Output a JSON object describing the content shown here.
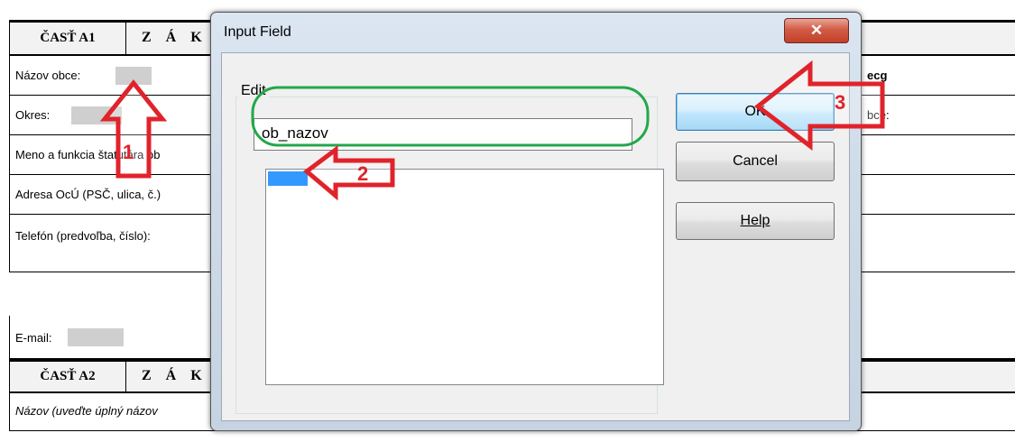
{
  "form": {
    "sectionA1": {
      "part": "ČASŤ A1",
      "heading": "Z Á K"
    },
    "rows": [
      {
        "label": "Názov obce:",
        "right_text": "ecg"
      },
      {
        "label": "Okres:",
        "right_text": "bce:"
      },
      {
        "label": "Meno a funkcia štatutára ob"
      },
      {
        "label": "Adresa OcÚ (PSČ, ulica, č.)"
      },
      {
        "label": "Telefón (predvoľba, číslo):"
      },
      {
        "label": "E-mail:"
      }
    ],
    "sectionA2": {
      "part": "ČASŤ A2",
      "heading": "Z Á K"
    },
    "last_row": {
      "label": "Názov (uveďte úplný názov"
    }
  },
  "dialog": {
    "title": "Input Field",
    "close_symbol": "✕",
    "group_label": "Edit",
    "edit_value": "ob_nazov",
    "buttons": {
      "ok": "OK",
      "cancel": "Cancel",
      "help": "Help"
    }
  },
  "annotations": {
    "markers": [
      "1",
      "2",
      "3"
    ],
    "color": "#e0232b",
    "highlight_color": "#22a84a"
  }
}
